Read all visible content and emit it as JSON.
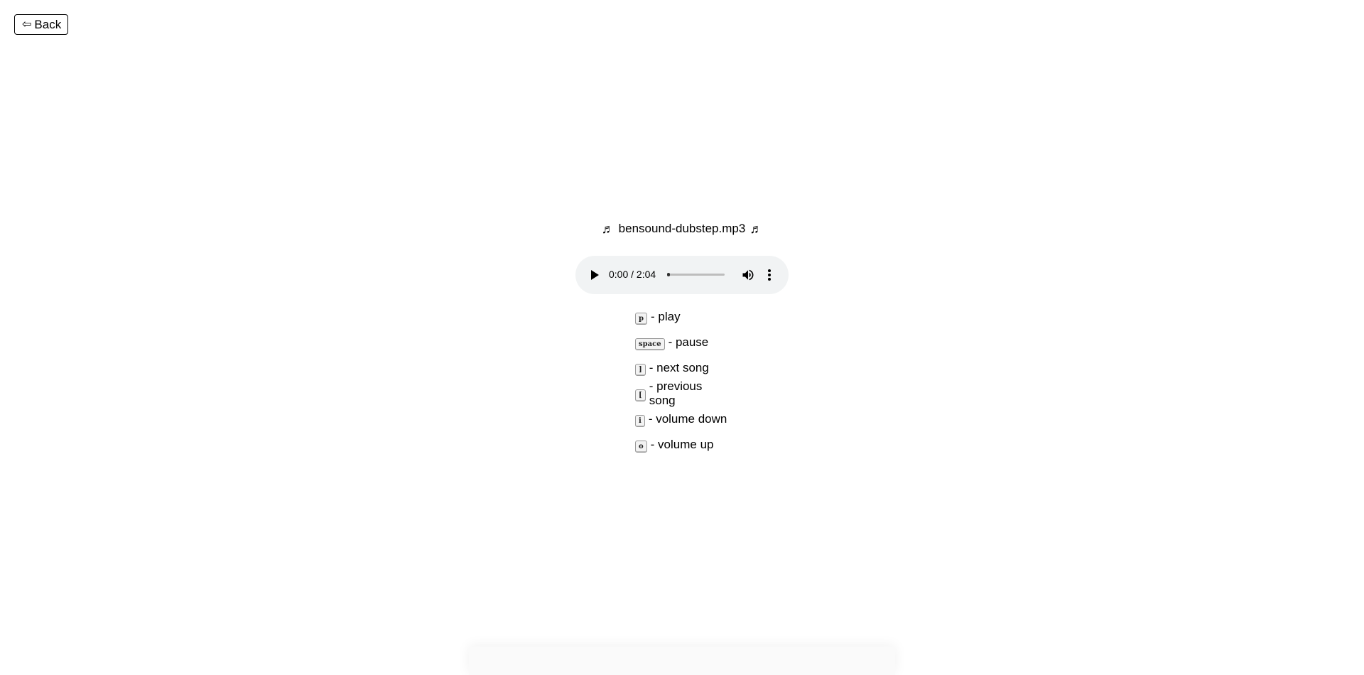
{
  "nav": {
    "back_label": "Back",
    "back_icon": "arrow-left-outline-icon"
  },
  "player": {
    "note_symbol": "♬",
    "song_title": "bensound-dubstep.mp3",
    "time_display": "0:00 / 2:04",
    "progress_fraction": 0
  },
  "shortcuts": [
    {
      "key": "p",
      "action": "- play"
    },
    {
      "key": "space",
      "action": "- pause"
    },
    {
      "key": "]",
      "action": "- next song"
    },
    {
      "key": "[",
      "action": "- previous song"
    },
    {
      "key": "i",
      "action": "- volume down"
    },
    {
      "key": "o",
      "action": "- volume up"
    }
  ],
  "colors": {
    "player_bg": "#f1f3f4",
    "text": "#000000"
  }
}
